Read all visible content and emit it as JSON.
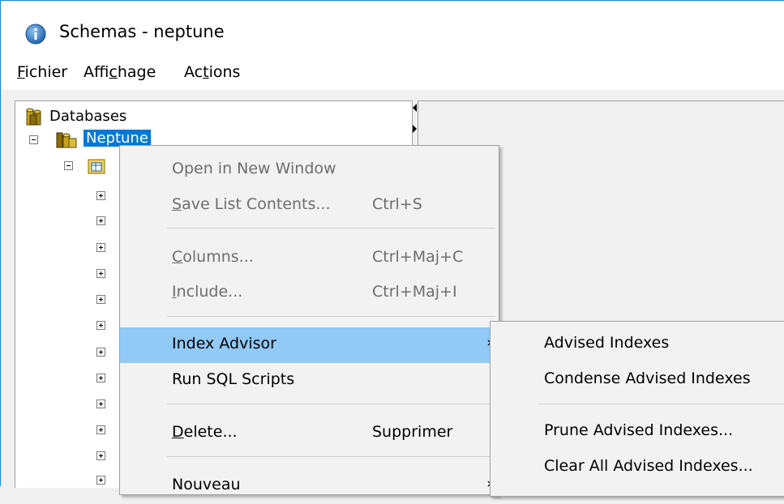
{
  "window": {
    "title": "Schemas - neptune",
    "icon": "info-globe-icon",
    "accent": "#1883d7"
  },
  "menubar": {
    "items": [
      {
        "label": "Fichier"
      },
      {
        "label": "Affichage"
      },
      {
        "label": "Actions"
      }
    ]
  },
  "tree": {
    "root_label": "Databases",
    "database_label": "Neptune",
    "selection_color": "#0078d7",
    "child_rows": 12
  },
  "context_menu": {
    "items": [
      {
        "label": "Open in New Window",
        "shortcut": "",
        "disabled": true
      },
      {
        "label": "Save List Contents...",
        "shortcut": "Ctrl+S",
        "disabled": true
      },
      {
        "label": "Columns...",
        "shortcut": "Ctrl+Maj+C",
        "disabled": true
      },
      {
        "label": "Include...",
        "shortcut": "Ctrl+Maj+I",
        "disabled": true
      },
      {
        "label": "Index Advisor",
        "shortcut": "",
        "submenu": true,
        "highlighted": true
      },
      {
        "label": "Run SQL Scripts",
        "shortcut": ""
      },
      {
        "label": "Delete...",
        "shortcut": "Supprimer"
      },
      {
        "label": "Nouveau",
        "shortcut": "",
        "submenu": true
      }
    ],
    "highlight_color": "#91c9f7"
  },
  "submenu": {
    "items": [
      {
        "label": "Advised Indexes"
      },
      {
        "label": "Condense Advised Indexes"
      },
      {
        "label": "Prune Advised Indexes..."
      },
      {
        "label": "Clear All Advised Indexes..."
      }
    ]
  }
}
